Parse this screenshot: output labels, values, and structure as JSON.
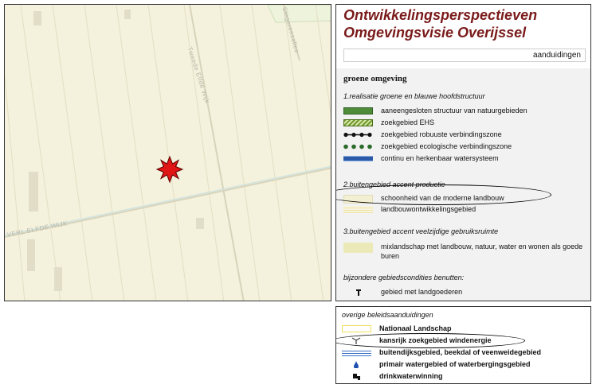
{
  "map": {
    "street_labels": [
      "Tweede Elfde Wijk",
      "Slegerensallee",
      "VERL ELFDE WIJK"
    ]
  },
  "legend": {
    "title_line1": "Ontwikkelingsperspectieven",
    "title_line2": "Omgevingsvisie Overijssel",
    "subtitle": "aanduidingen",
    "section_heading": "groene omgeving",
    "categories": [
      "1.realisatie groene en blauwe hoofdstructuur",
      "2.buitengebied accent productie",
      "3.buitengebied accent veelzijdige gebruiksruimte",
      "bijzondere gebiedscondities benutten:"
    ],
    "items": [
      {
        "label": "aaneengesloten structuur van natuurgebieden",
        "color": "#4e8c3a"
      },
      {
        "label": "zoekgebied EHS",
        "color": "#6f9a2e"
      },
      {
        "label": "zoekgebied robuuste verbindingszone",
        "color": "#111111"
      },
      {
        "label": "zoekgebied ecologische verbindingszone",
        "color": "#2a6b2a"
      },
      {
        "label": "continu en herkenbaar watersysteem",
        "color": "#2b5ba8"
      },
      {
        "label": "schoonheid van de moderne landbouw",
        "color": "#f3efd3"
      },
      {
        "label": "landbouwontwikkelingsgebied",
        "color": "#efe3a8"
      },
      {
        "label": "mixlandschap met landbouw, natuur, water en wonen als goede buren",
        "color": "#ece9b8"
      },
      {
        "label": "gebied met landgoederen",
        "icon": "tree-icon"
      }
    ]
  },
  "legend2": {
    "category": "overige beleidsaanduidingen",
    "items": [
      {
        "label": "Nationaal Landschap",
        "color": "#f0e060"
      },
      {
        "label": "kansrijk zoekgebied windenergie",
        "icon": "wind-turbine-icon"
      },
      {
        "label": "buitendijksgebied, beekdal of veenweidegebied",
        "color": "#3b6fc4"
      },
      {
        "label": "primair watergebied of waterbergingsgebied",
        "icon": "water-drop-icon"
      },
      {
        "label": "drinkwaterwinning",
        "icon": "water-tap-icon"
      }
    ]
  }
}
